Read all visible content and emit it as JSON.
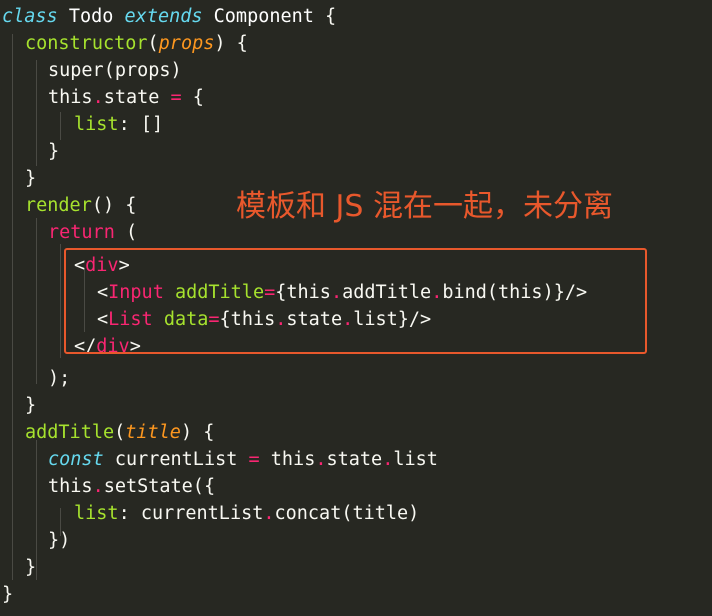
{
  "annotation": "模板和 JS 混在一起，未分离",
  "code": {
    "l1": {
      "kw_class": "class",
      "name": "Todo",
      "kw_extends": "extends",
      "parent": "Component",
      "brace": "{"
    },
    "l2": {
      "fn": "constructor",
      "open": "(",
      "param": "props",
      "close": ") {"
    },
    "l3": {
      "text": "super(props)"
    },
    "l4": {
      "this": "this",
      "dot": ".",
      "prop": "state ",
      "eq": "=",
      "rest": " {"
    },
    "l5": {
      "key": "list",
      "rest": ": []"
    },
    "l6": {
      "text": "}"
    },
    "l7": {
      "text": "}"
    },
    "l8": {
      "fn": "render",
      "rest": "() {"
    },
    "l9": {
      "kw": "return",
      "rest": " ("
    },
    "l10": {
      "open": "<",
      "tag": "div",
      "close": ">"
    },
    "l11": {
      "open": "<",
      "tag": "Input",
      "attr": " addTitle",
      "eq": "=",
      "p1": "{this",
      "d1": ".",
      "p2": "addTitle",
      "d2": ".",
      "p3": "bind(this)}/>"
    },
    "l12": {
      "open": "<",
      "tag": "List",
      "attr": " data",
      "eq": "=",
      "p1": "{this",
      "d1": ".",
      "p2": "state",
      "d2": ".",
      "p3": "list}/>"
    },
    "l13": {
      "open": "</",
      "tag": "div",
      "close": ">"
    },
    "l14": {
      "text": ");"
    },
    "l15": {
      "text": "}"
    },
    "l16": {
      "fn": "addTitle",
      "open": "(",
      "param": "title",
      "close": ") {"
    },
    "l17": {
      "kw": "const",
      "var": " currentList ",
      "eq": "=",
      "p1": " this",
      "d1": ".",
      "p2": "state",
      "d2": ".",
      "p3": "list"
    },
    "l18": {
      "this": "this",
      "dot": ".",
      "rest": "setState({"
    },
    "l19": {
      "key": "list",
      "p1": ": currentList",
      "dot": ".",
      "p2": "concat(title)"
    },
    "l20": {
      "text": "})"
    },
    "l21": {
      "text": "}"
    },
    "l22": {
      "text": "}"
    }
  }
}
